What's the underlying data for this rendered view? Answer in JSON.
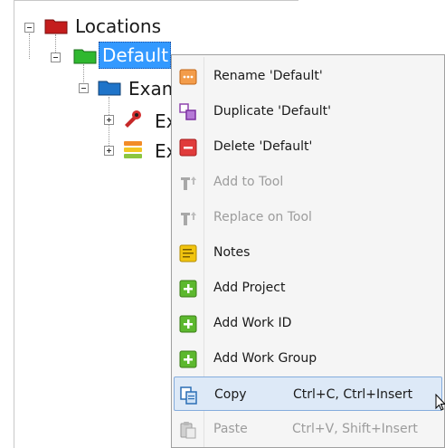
{
  "tree": {
    "root_label": "Locations",
    "default_label": "Default",
    "example_label": "Exam",
    "child1_label": "Ex",
    "child2_label": "Ex"
  },
  "context_menu": {
    "items": [
      {
        "label": "Rename 'Default'",
        "icon": "rename-icon"
      },
      {
        "label": "Duplicate 'Default'",
        "icon": "duplicate-icon"
      },
      {
        "label": "Delete 'Default'",
        "icon": "delete-icon"
      },
      {
        "label": "Add to Tool",
        "icon": "add-to-tool-icon",
        "disabled": true
      },
      {
        "label": "Replace on Tool",
        "icon": "replace-on-tool-icon",
        "disabled": true
      },
      {
        "label": "Notes",
        "icon": "notes-icon"
      },
      {
        "label": "Add Project",
        "icon": "plus-icon"
      },
      {
        "label": "Add Work ID",
        "icon": "plus-icon"
      },
      {
        "label": "Add Work Group",
        "icon": "plus-icon"
      },
      {
        "label": "Copy",
        "shortcut": "Ctrl+C, Ctrl+Insert",
        "icon": "copy-icon",
        "hovered": true
      },
      {
        "label": "Paste",
        "shortcut": "Ctrl+V, Shift+Insert",
        "icon": "paste-icon",
        "disabled": true
      }
    ]
  },
  "colors": {
    "selection": "#3399ff",
    "hover_bg": "#dde9f7",
    "disabled_text": "#9c9c9c"
  }
}
